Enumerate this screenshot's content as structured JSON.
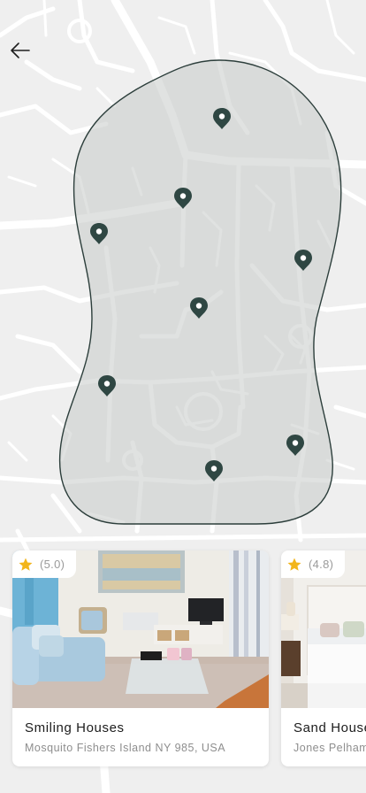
{
  "map": {
    "search_area": "drawn-area-polygon",
    "pin_icon": "map-marker-icon",
    "pin_count": 8
  },
  "nav": {
    "back_icon": "arrow-left-icon"
  },
  "listings": [
    {
      "rating": "(5.0)",
      "title": "Smiling Houses",
      "address": "Mosquito Fishers Island NY 985, USA",
      "star_icon": "star-icon"
    },
    {
      "rating": "(4.8)",
      "title": "Sand House",
      "address": "Jones Pelham",
      "star_icon": "star-icon"
    }
  ],
  "colors": {
    "map_background": "#efefef",
    "road": "#ffffff",
    "area_fill": "#dcdedd",
    "area_outline": "#2c3e3b",
    "pin": "#2f4743",
    "star": "#f2b51c"
  }
}
